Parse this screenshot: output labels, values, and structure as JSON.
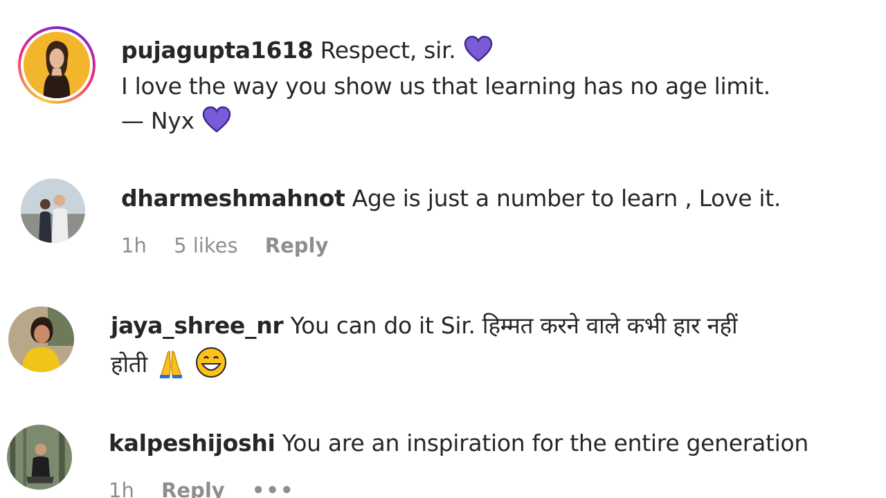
{
  "comments": [
    {
      "username": "pujagupta1618",
      "line1": "Respect, sir.",
      "line2": "I love the way you show us that learning has no age limit.",
      "line3": "— Nyx",
      "heart_color": "#7a5cdb"
    },
    {
      "username": "dharmeshmahnot",
      "text": "Age is just a number to learn , Love it.",
      "time": "1h",
      "likes": "5 likes",
      "reply": "Reply"
    },
    {
      "username": "jaya_shree_nr",
      "line1": "You can do it Sir. हिम्मत करने वाले कभी हार नहीं",
      "line2": "होती",
      "emojis": [
        "folded-hands-icon",
        "grinning-face-icon"
      ]
    },
    {
      "username": "kalpeshijoshi",
      "text": "You are an inspiration for the entire generation",
      "time": "1h",
      "reply": "Reply",
      "more": "•••"
    }
  ]
}
